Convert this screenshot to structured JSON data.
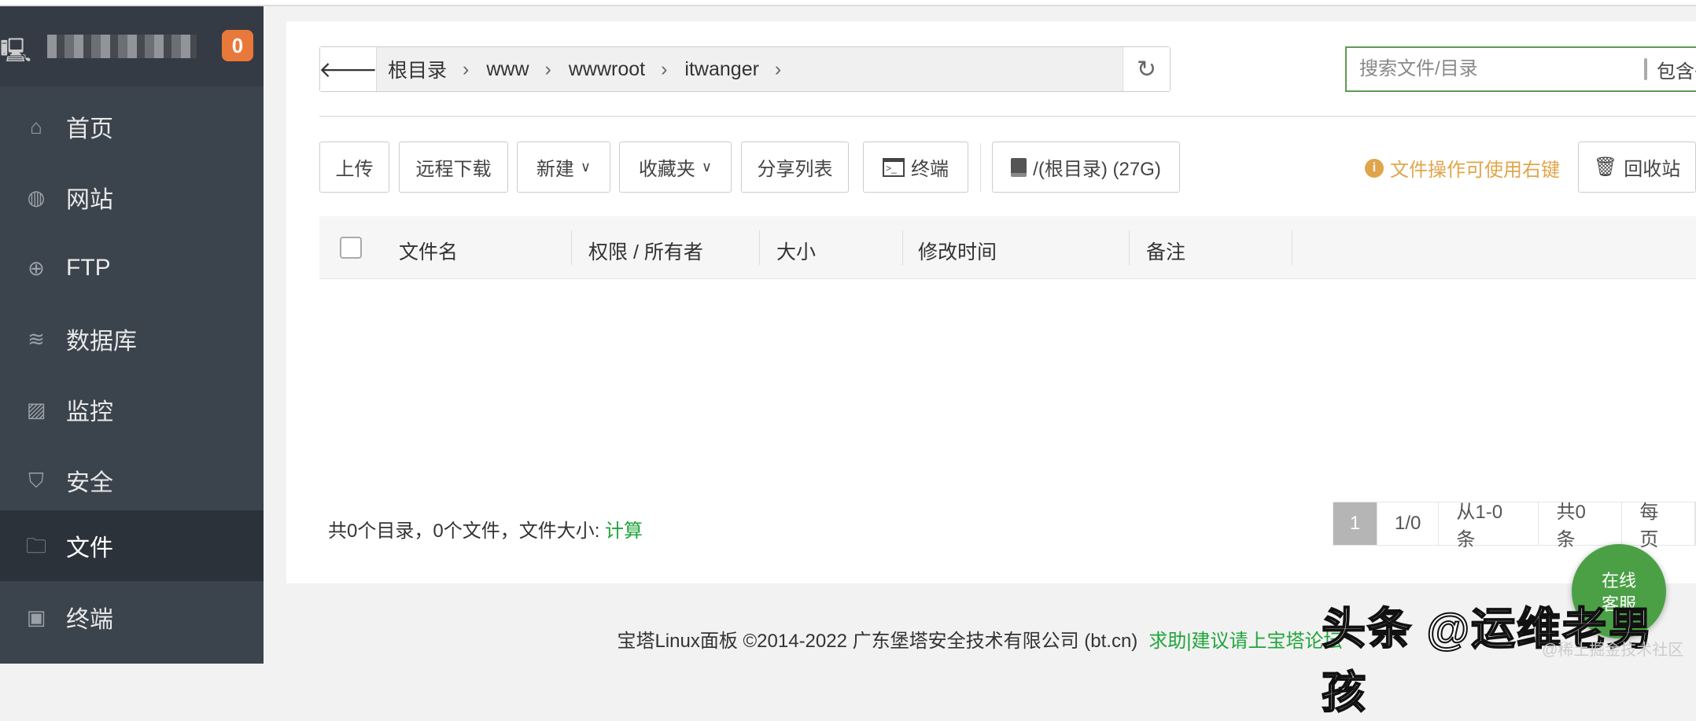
{
  "sidebar": {
    "server_badge": "0",
    "items": [
      {
        "label": "首页",
        "icon": "home-icon"
      },
      {
        "label": "网站",
        "icon": "globe-icon"
      },
      {
        "label": "FTP",
        "icon": "ftp-icon"
      },
      {
        "label": "数据库",
        "icon": "database-icon"
      },
      {
        "label": "监控",
        "icon": "monitor-icon"
      },
      {
        "label": "安全",
        "icon": "shield-icon"
      },
      {
        "label": "文件",
        "icon": "folder-icon",
        "active": true
      },
      {
        "label": "终端",
        "icon": "terminal-icon"
      }
    ]
  },
  "breadcrumb": {
    "segments": [
      "根目录",
      "www",
      "wwwroot",
      "itwanger"
    ]
  },
  "search": {
    "placeholder": "搜索文件/目录",
    "include_sub_label": "包含子"
  },
  "toolbar": {
    "upload": "上传",
    "remote_download": "远程下载",
    "new": "新建",
    "favorites": "收藏夹",
    "share_list": "分享列表",
    "terminal": "终端",
    "disk": "/(根目录) (27G)",
    "tip": "文件操作可使用右键",
    "recycle_bin": "回收站"
  },
  "table": {
    "columns": [
      "文件名",
      "权限 / 所有者",
      "大小",
      "修改时间",
      "备注"
    ]
  },
  "summary": {
    "text": "共0个目录，0个文件，文件大小: ",
    "calc": "计算"
  },
  "pagination": {
    "current": "1",
    "pages": "1/0",
    "range": "从1-0条",
    "total": "共0条",
    "per_page": "每页"
  },
  "footer": {
    "copyright": "宝塔Linux面板 ©2014-2022 广东堡塔安全技术有限公司 (bt.cn)",
    "link": "求助|建议请上宝塔论坛"
  },
  "chat": {
    "label": "在线客服"
  },
  "watermark": {
    "main": "头条 @运维老男孩",
    "sub": "@稀土掘金技术社区"
  }
}
